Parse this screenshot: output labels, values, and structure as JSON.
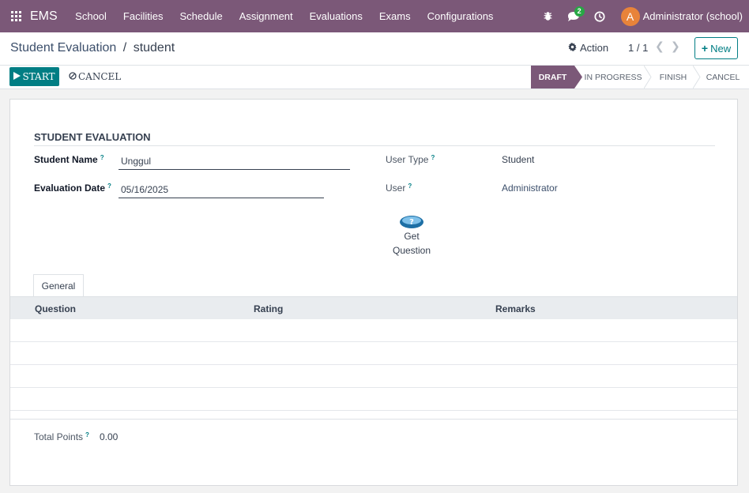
{
  "navbar": {
    "brand": "EMS",
    "menu": [
      "School",
      "Facilities",
      "Schedule",
      "Assignment",
      "Evaluations",
      "Exams",
      "Configurations"
    ],
    "chat_count": "2",
    "avatar_letter": "A",
    "user": "Administrator (school)"
  },
  "control": {
    "breadcrumb_parent": "Student Evaluation",
    "breadcrumb_sep": "/",
    "breadcrumb_current": "student",
    "action_label": "Action",
    "pager": "1 / 1",
    "new_label": "New"
  },
  "statusbar": {
    "start_label": "START",
    "cancel_label": "CANCEL",
    "stages": [
      "DRAFT",
      "IN PROGRESS",
      "FINISH",
      "CANCEL"
    ],
    "active_stage": "DRAFT"
  },
  "form": {
    "section_title": "STUDENT EVALUATION",
    "student_name_label": "Student Name",
    "student_name_value": "Unggul",
    "evaluation_date_label": "Evaluation Date",
    "evaluation_date_value": "05/16/2025",
    "user_type_label": "User Type",
    "user_type_value": "Student",
    "user_label": "User",
    "user_value": "Administrator",
    "tooltip_mark": "?",
    "get_question_label_1": "Get",
    "get_question_label_2": "Question"
  },
  "tabs": [
    "General"
  ],
  "table": {
    "columns": [
      "Question",
      "Rating",
      "Remarks"
    ],
    "rows": []
  },
  "footer": {
    "total_points_label": "Total Points",
    "total_points_value": "0.00"
  },
  "colors": {
    "navbar": "#7b5878",
    "primary": "#017e84",
    "link": "#3c4f6b"
  }
}
